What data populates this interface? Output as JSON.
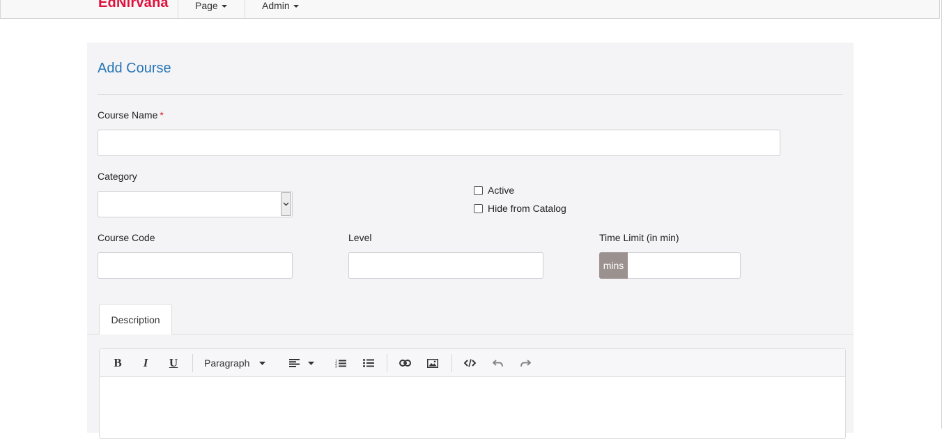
{
  "navbar": {
    "brand": "EdNirvana",
    "items": [
      {
        "label": "Page"
      },
      {
        "label": "Admin"
      }
    ]
  },
  "form": {
    "title": "Add Course",
    "course_name": {
      "label": "Course Name",
      "required_mark": "*",
      "value": ""
    },
    "category": {
      "label": "Category",
      "selected": ""
    },
    "active": {
      "label": "Active",
      "checked": false
    },
    "hide_from_catalog": {
      "label": "Hide from Catalog",
      "checked": false
    },
    "course_code": {
      "label": "Course Code",
      "value": ""
    },
    "level": {
      "label": "Level",
      "value": ""
    },
    "time_limit": {
      "label": "Time Limit (in min)",
      "addon": "mins",
      "value": ""
    }
  },
  "tabs": [
    {
      "label": "Description",
      "active": true
    }
  ],
  "editor": {
    "block_format": "Paragraph",
    "toolbar_icons": [
      "bold-icon",
      "italic-icon",
      "underline-icon",
      "align-left-icon",
      "ordered-list-icon",
      "unordered-list-icon",
      "link-icon",
      "image-icon",
      "code-icon",
      "undo-icon",
      "redo-icon"
    ]
  },
  "colors": {
    "brand": "#e0103c",
    "title": "#2775b6",
    "addon": "#9b918f",
    "panel": "#f4f4f6"
  }
}
